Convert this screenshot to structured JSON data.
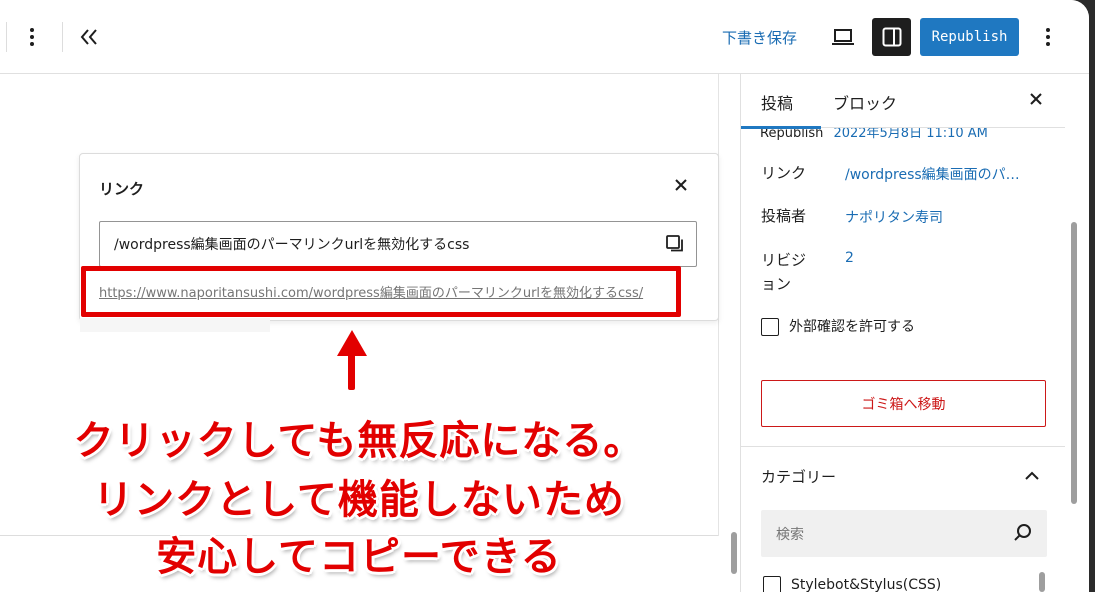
{
  "toolbar": {
    "more_icon": "vertical-ellipsis-icon",
    "collapse_icon": "double-chevron-left-icon",
    "save_draft_label": "下書き保存",
    "preview_icon": "laptop-icon",
    "settings_icon": "sidebar-toggle-icon",
    "republish_label": "Republish",
    "options_icon": "vertical-ellipsis-icon"
  },
  "link_popover": {
    "title": "リンク",
    "slug_value": "/wordpress編集画面のパーマリンクurlを無効化するcss",
    "full_url": "https://www.naporitansushi.com/wordpress編集画面のパーマリンクurlを無効化するcss/"
  },
  "annotation": {
    "line1": "クリックしても無反応になる。",
    "line2": "リンクとして機能しないため",
    "line3": "安心してコピーできる",
    "color": "#e20000"
  },
  "sidebar": {
    "tabs": [
      {
        "label": "投稿"
      },
      {
        "label": "ブロック"
      }
    ],
    "cut_row": {
      "label": "Republish",
      "value": "2022年5月8日 11:10 AM"
    },
    "rows": [
      {
        "label": "リンク",
        "value": "/wordpress編集画面のパ…"
      },
      {
        "label": "投稿者",
        "value": "ナポリタン寿司"
      },
      {
        "label": "リビジョン",
        "value": "2"
      }
    ],
    "allow_external_label": "外部確認を許可する",
    "trash_label": "ゴミ箱へ移動",
    "category_heading": "カテゴリー",
    "search_placeholder": "検索",
    "category_item": "Stylebot&Stylus(CSS)"
  },
  "colors": {
    "accent": "#1f78c1",
    "link": "#1a6cb3",
    "danger": "#cc1818"
  }
}
